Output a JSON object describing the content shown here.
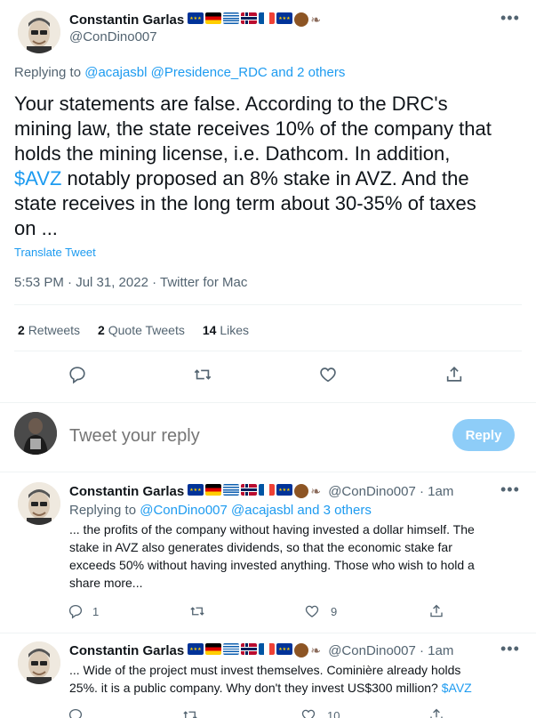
{
  "main_tweet": {
    "author_name": "Constantin Garlas",
    "handle": "@ConDino007",
    "replying_label": "Replying to",
    "replying_to": "@acajasbl @Presidence_RDC and 2 others",
    "text_line1": "Your statements are false. According to the DRC's",
    "text_line2": "mining law, the state receives 10% of the company that",
    "text_line3": "holds the mining license, i.e. Dathcom. In addition,",
    "text_cashtag": "$AVZ",
    "text_line4_rest": " notably proposed an 8% stake in AVZ. And the",
    "text_line5": "state receives in the long term about 30-35% of taxes",
    "text_line6": "on ...",
    "translate": "Translate Tweet",
    "time": "5:53 PM · Jul 31, 2022 ·",
    "source": "Twitter for Mac",
    "retweets_count": "2",
    "retweets_label": "Retweets",
    "quotes_count": "2",
    "quotes_label": "Quote Tweets",
    "likes_count": "14",
    "likes_label": "Likes"
  },
  "composer": {
    "placeholder": "Tweet your reply",
    "reply_button": "Reply"
  },
  "replies": [
    {
      "author_name": "Constantin Garlas",
      "handle_time": "@ConDino007 · 1am",
      "replying_label": "Replying to",
      "replying_to": "@ConDino007 @acajasbl and 3 others",
      "line1": "... the profits of the company without having invested a dollar himself. The",
      "line2": "stake in AVZ also generates dividends, so that the economic stake far",
      "line3": "exceeds 50% without having invested anything. Those who wish to hold a",
      "line4": "share more...",
      "reply_count": "1",
      "like_count": "9"
    },
    {
      "author_name": "Constantin Garlas",
      "handle_time": "@ConDino007 · 1am",
      "line1": "... Wide of the project must invest themselves. Cominière already holds",
      "line2": "25%. it is a public company. Why don't they invest US$300 million?",
      "cashtag": "$AVZ",
      "like_count": "10"
    }
  ],
  "icons": {
    "reply": "reply-icon",
    "retweet": "retweet-icon",
    "like": "heart-icon",
    "share": "share-icon",
    "more": "more-icon"
  },
  "colors": {
    "accent": "#1d9bf0",
    "reply_button_disabled": "#8ecdf8",
    "muted": "#536471"
  }
}
